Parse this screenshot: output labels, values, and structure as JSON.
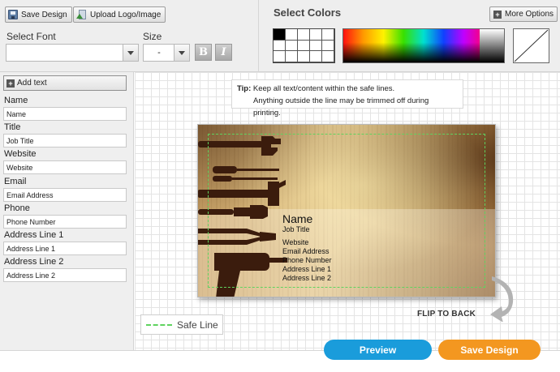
{
  "toolbar": {
    "save_design_label": "Save Design",
    "upload_label": "Upload Logo/Image",
    "select_font_label": "Select Font",
    "font_value": "",
    "size_label": "Size",
    "size_value": "-",
    "bold_label": "B",
    "italic_label": "I"
  },
  "colors": {
    "heading": "Select Colors",
    "more_options_label": "More Options"
  },
  "sidebar": {
    "add_text_label": "Add text",
    "fields": [
      {
        "label": "Name",
        "value": "Name"
      },
      {
        "label": "Title",
        "value": "Job Title"
      },
      {
        "label": "Website",
        "value": "Website"
      },
      {
        "label": "Email",
        "value": "Email Address"
      },
      {
        "label": "Phone",
        "value": "Phone Number"
      },
      {
        "label": "Address Line 1",
        "value": "Address Line 1"
      },
      {
        "label": "Address Line 2",
        "value": "Address Line 2"
      }
    ]
  },
  "tip": {
    "prefix": "Tip:",
    "line1": "Keep all text/content within the safe lines.",
    "line2": "Anything outside the line may be trimmed off during printing."
  },
  "card": {
    "name": "Name",
    "title": "Job Title",
    "website": "Website",
    "email": "Email Address",
    "phone": "Phone Number",
    "address1": "Address Line 1",
    "address2": "Address Line 2"
  },
  "flip_label": "FLIP TO BACK",
  "safe_line_label": "Safe Line",
  "bottom": {
    "preview_label": "Preview",
    "save_label": "Save Design"
  },
  "palette": {
    "accent_blue": "#1a9cdb",
    "accent_orange": "#f39720",
    "safe_line_green": "#5fd35f"
  }
}
